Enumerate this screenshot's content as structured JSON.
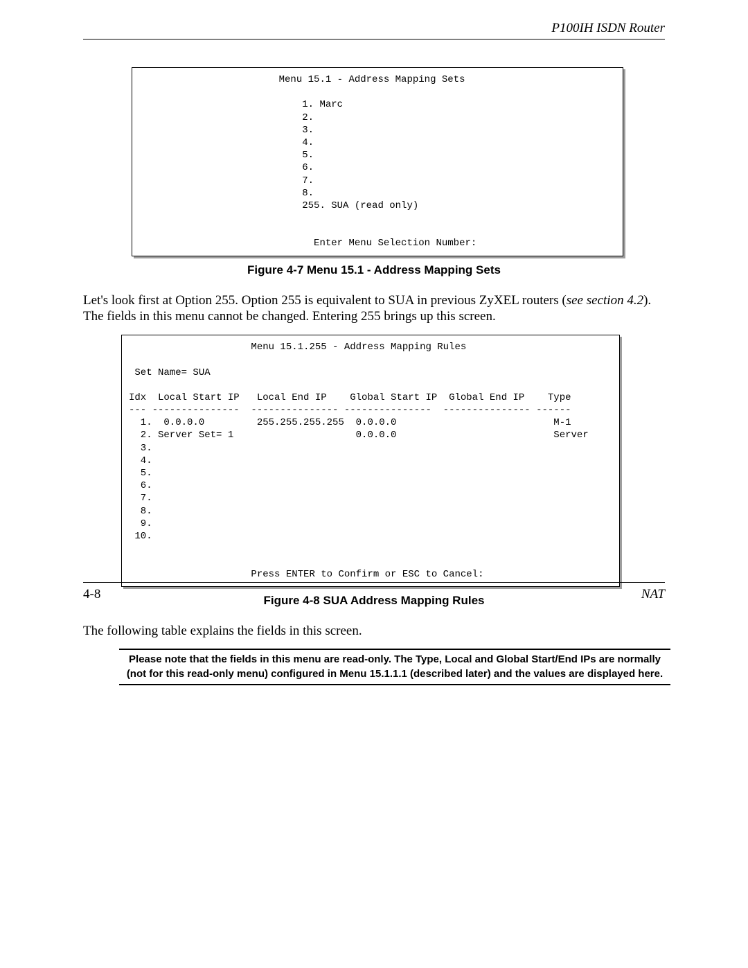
{
  "header": {
    "title": "P100IH ISDN Router"
  },
  "menu1": {
    "text": "                        Menu 15.1 - Address Mapping Sets\n\n                            1. Marc\n                            2.\n                            3.\n                            4.\n                            5.\n                            6.\n                            7.\n                            8.\n                            255. SUA (read only)\n\n\n                              Enter Menu Selection Number:"
  },
  "caption1": "Figure 4-7 Menu 15.1 - Address Mapping Sets",
  "para1_a": "Let's look first at Option 255. Option 255 is equivalent to SUA in previous ZyXEL routers (",
  "para1_em": "see section 4.2",
  "para1_b": "). The fields in this menu cannot be changed. Entering 255 brings up this screen.",
  "menu2": {
    "text": "                     Menu 15.1.255 - Address Mapping Rules\n\n Set Name= SUA\n\nIdx  Local Start IP   Local End IP    Global Start IP  Global End IP    Type\n--- ---------------  --------------- ---------------  --------------- ------\n  1.  0.0.0.0         255.255.255.255  0.0.0.0                           M-1\n  2. Server Set= 1                     0.0.0.0                           Server\n  3.\n  4.\n  5.\n  6.\n  7.\n  8.\n  9.\n 10.\n\n\n                     Press ENTER to Confirm or ESC to Cancel:"
  },
  "caption2": "Figure 4-8 SUA Address Mapping Rules",
  "para2": "The following table explains the fields in this screen.",
  "note": "Please note that the fields in this menu are read-only. The Type, Local and Global Start/End IPs are normally (not for this read-only menu) configured in Menu 15.1.1.1 (described later) and the values are displayed here.",
  "footer": {
    "page": "4-8",
    "section": "NAT"
  }
}
